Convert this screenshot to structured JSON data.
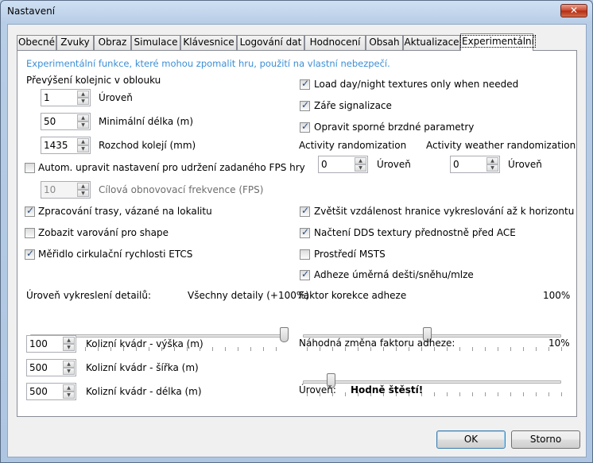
{
  "window": {
    "title": "Nastavení",
    "close_label": "✕"
  },
  "tabs": [
    "Obecné",
    "Zvuky",
    "Obraz",
    "Simulace",
    "Klávesnice",
    "Logování dat",
    "Hodnocení",
    "Obsah",
    "Aktualizace",
    "Experimentální"
  ],
  "active_tab": "Experimentální",
  "warning": "Experimentální funkce, které mohou zpomalit hru, použití na vlastní nebezpečí.",
  "superelevation": {
    "heading": "Převýšení kolejnic v oblouku",
    "level": {
      "value": "1",
      "label": "Úroveň"
    },
    "min_length": {
      "value": "50",
      "label": "Minimální délka (m)"
    },
    "gauge": {
      "value": "1435",
      "label": "Rozchod kolejí (mm)"
    }
  },
  "fps": {
    "checkbox_label": "Autom. upravit nastavení pro udržení zadaného FPS hry",
    "checked": false,
    "target": {
      "value": "10",
      "label": "Cílová obnovovací frekvence (FPS)"
    }
  },
  "left_checkboxes": [
    {
      "label": "Zpracování trasy, vázané na lokalitu",
      "checked": true
    },
    {
      "label": "Zobazit varování pro shape",
      "checked": false
    },
    {
      "label": "Měřidlo cirkulační rychlosti ETCS",
      "checked": true
    }
  ],
  "right_checkboxes_top": [
    {
      "label": "Load day/night textures only when needed",
      "checked": true
    },
    {
      "label": "Záře signalizace",
      "checked": true
    },
    {
      "label": "Opravit sporné brzdné parametry",
      "checked": true
    }
  ],
  "activity_randomization": {
    "label": "Activity randomization",
    "value": "0",
    "unit": "Úroveň"
  },
  "activity_weather_randomization": {
    "label": "Activity weather randomization",
    "value": "0",
    "unit": "Úroveň"
  },
  "right_checkboxes_bottom": [
    {
      "label": "Zvětšit vzdálenost hranice vykreslování až k horizontu",
      "checked": true
    },
    {
      "label": "Načtení DDS textury přednostně před ACE",
      "checked": true
    },
    {
      "label": "Prostředí MSTS",
      "checked": false
    },
    {
      "label": "Adheze úměrná dešti/sněhu/mlze",
      "checked": true
    }
  ],
  "detail_level": {
    "label": "Úroveň vykreslení detailů:",
    "value_text": "Všechny detaily (+100%)",
    "fraction": 1.0
  },
  "adhesion_factor": {
    "label": "Faktor korekce adheze",
    "value_text": "100%",
    "fraction": 0.5
  },
  "adhesion_random": {
    "label": "Náhodná změna faktoru adheze:",
    "value_text": "10%",
    "fraction": 0.1
  },
  "adhesion_level": {
    "label": "Úroveň:",
    "value": "Hodně štěstí!"
  },
  "collision_box": [
    {
      "value": "100",
      "label": "Kolizní kvádr - výška (m)"
    },
    {
      "value": "500",
      "label": "Kolizní kvádr - šířka (m)"
    },
    {
      "value": "500",
      "label": "Kolizní kvádr - délka (m)"
    }
  ],
  "buttons": {
    "ok": "OK",
    "cancel": "Storno"
  }
}
